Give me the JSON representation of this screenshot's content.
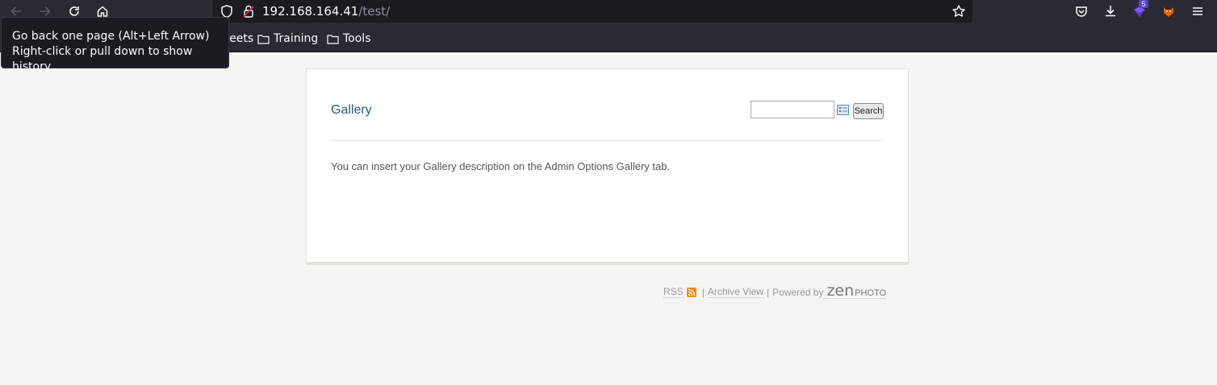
{
  "browser": {
    "url_host": "192.168.164.41",
    "url_path": "/test/",
    "extension_badge": "5",
    "bookmarks": [
      {
        "label": "heat sheets"
      },
      {
        "label": "Training"
      },
      {
        "label": "Tools"
      }
    ],
    "tooltip": {
      "line1": "Go back one page (Alt+Left Arrow)",
      "line2": "Right-click or pull down to show history"
    }
  },
  "page": {
    "title": "Gallery",
    "search_button": "Search",
    "search_value": "",
    "description": "You can insert your Gallery description on the Admin Options Gallery tab.",
    "footer": {
      "rss": "RSS",
      "separator": "|",
      "archive": "Archive View",
      "powered_by": "Powered by",
      "logo_zen": "zen",
      "logo_photo": "PHOTO"
    }
  },
  "colors": {
    "chrome": "#2b2a33",
    "urlbar": "#1c1b22",
    "page_bg": "#f4f4f1",
    "title": "#2b5a86",
    "rss": "#f08a24"
  }
}
